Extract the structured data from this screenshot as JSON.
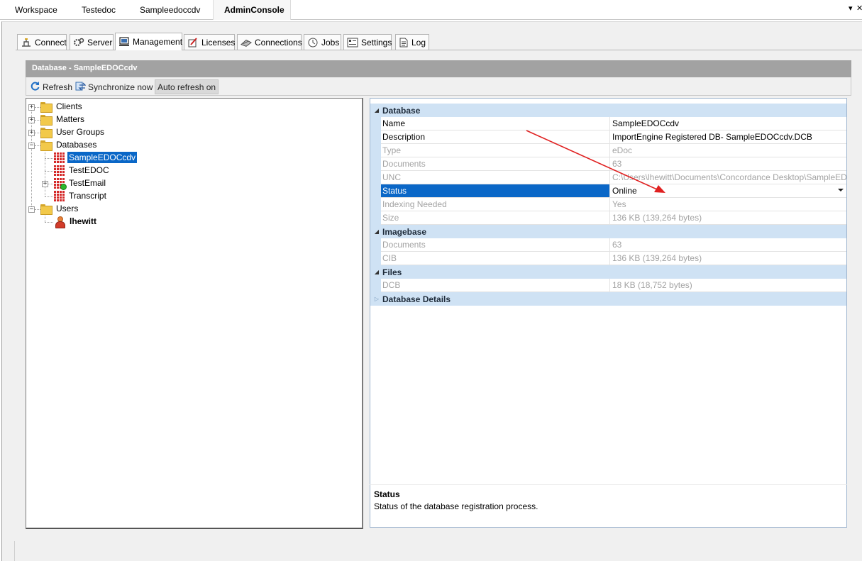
{
  "doc_tabs": [
    {
      "label": "Workspace"
    },
    {
      "label": "Testedoc"
    },
    {
      "label": "Sampleedoccdv"
    },
    {
      "label": "AdminConsole"
    }
  ],
  "tab_controls": {
    "dropdown": "▾",
    "close": "✕"
  },
  "management_tabs": [
    {
      "label": "Connect",
      "icon": "connect-icon"
    },
    {
      "label": "Server",
      "icon": "server-icon"
    },
    {
      "label": "Management",
      "icon": "management-icon"
    },
    {
      "label": "Licenses",
      "icon": "licenses-icon"
    },
    {
      "label": "Connections",
      "icon": "connections-icon"
    },
    {
      "label": "Jobs",
      "icon": "jobs-icon"
    },
    {
      "label": "Settings",
      "icon": "settings-icon"
    },
    {
      "label": "Log",
      "icon": "log-icon"
    }
  ],
  "header": {
    "title": "Database - SampleEDOCcdv"
  },
  "toolbar": {
    "refresh": "Refresh",
    "synchronize": "Synchronize now",
    "auto_refresh": "Auto refresh on"
  },
  "tree": {
    "clients": "Clients",
    "matters": "Matters",
    "user_groups": "User Groups",
    "databases": "Databases",
    "db_sample": "SampleEDOCcdv",
    "db_testedoc": "TestEDOC",
    "db_testemail": "TestEmail",
    "db_transcript": "Transcript",
    "users": "Users",
    "user_lhewitt": "lhewitt"
  },
  "property_grid": {
    "database_category": "Database",
    "name_label": "Name",
    "name_value": "SampleEDOCcdv",
    "description_label": "Description",
    "description_value": "ImportEngine Registered DB- SampleEDOCcdv.DCB",
    "type_label": "Type",
    "type_value": "eDoc",
    "documents_label": "Documents",
    "documents_value": "63",
    "unc_label": "UNC",
    "unc_value": "C:\\Users\\lhewitt\\Documents\\Concordance Desktop\\SampleEDOCcdv",
    "status_label": "Status",
    "status_value": "Online",
    "indexing_label": "Indexing Needed",
    "indexing_value": "Yes",
    "size_label": "Size",
    "size_value": "136 KB (139,264 bytes)",
    "imagebase_category": "Imagebase",
    "img_documents_label": "Documents",
    "img_documents_value": "63",
    "cib_label": "CIB",
    "cib_value": "136 KB (139,264 bytes)",
    "files_category": "Files",
    "dcb_label": "DCB",
    "dcb_value": "18 KB (18,752 bytes)",
    "details_category": "Database Details"
  },
  "help": {
    "title": "Status",
    "text": "Status of the database registration process."
  },
  "colors": {
    "selection": "#0a67c7",
    "category_bg": "#cfe2f4",
    "annotation_arrow": "#e02020"
  }
}
